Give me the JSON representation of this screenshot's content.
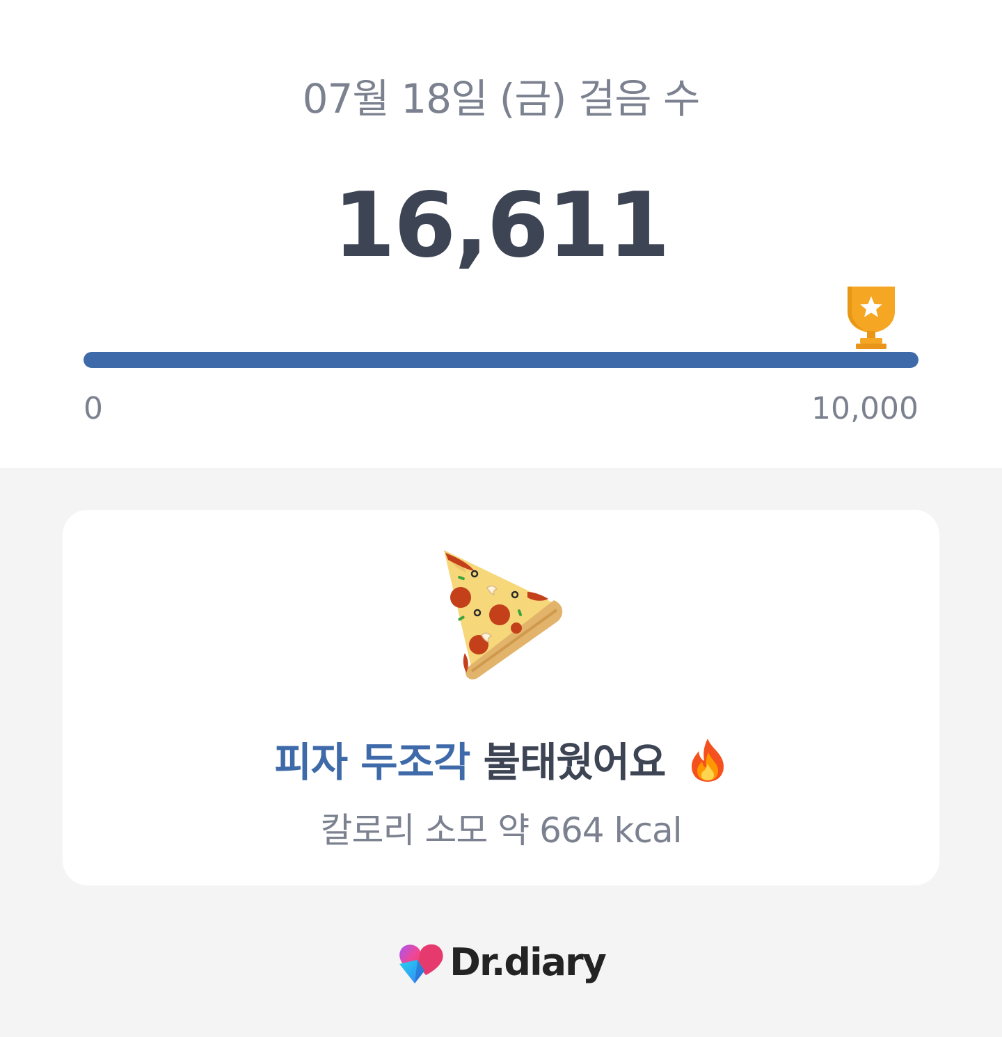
{
  "header": {
    "date_title": "07월 18일 (금) 걸음 수",
    "steps_display": "16,611"
  },
  "progress": {
    "min_label": "0",
    "max_label": "10,000",
    "fraction": 1.0,
    "bar_color": "#3f6aa9",
    "goal_icon": "trophy-icon"
  },
  "card": {
    "food_icon": "pizza-slice-icon",
    "headline_highlight": "피자 두조각",
    "headline_rest": "불태웠어요",
    "headline_emoji_icon": "fire-icon",
    "calorie_text": "칼로리 소모 약 664 kcal"
  },
  "brand": {
    "name": "Dr.diary",
    "logo_icon": "heart-logo-icon"
  },
  "colors": {
    "accent": "#3f6aa9",
    "trophy": "#f5a623",
    "text_dark": "#3d4454",
    "text_muted": "#7c8190"
  }
}
